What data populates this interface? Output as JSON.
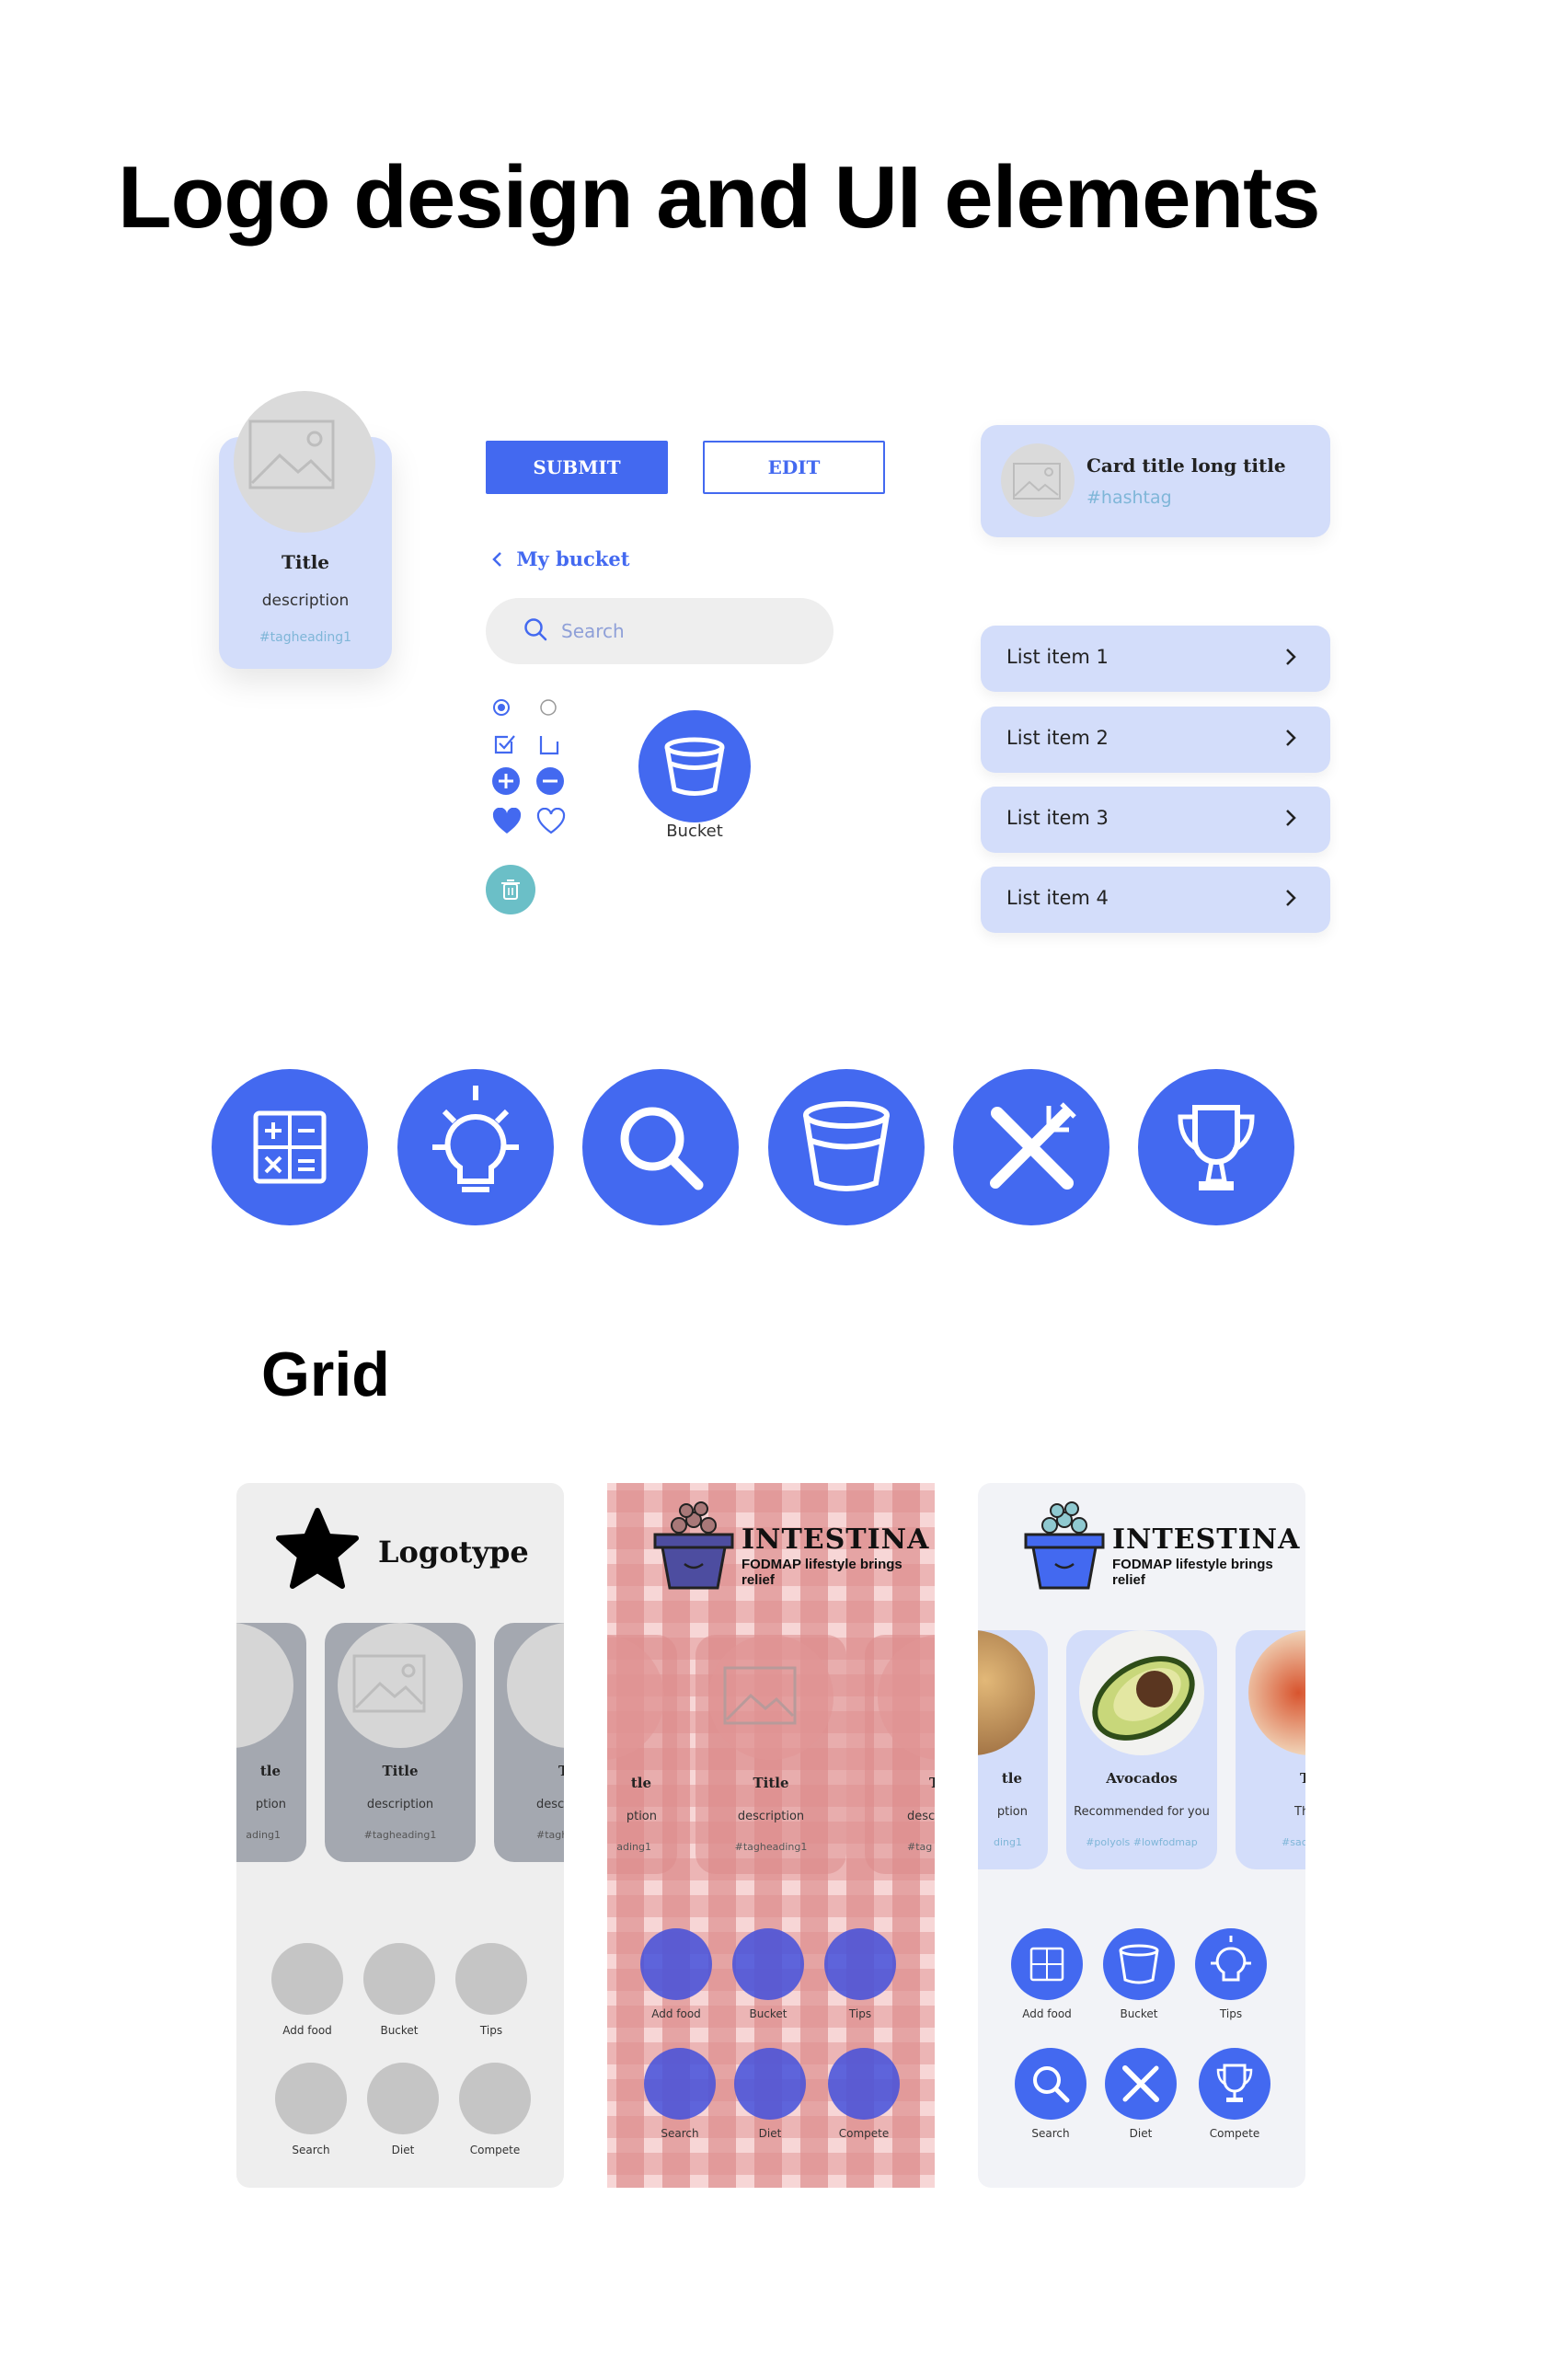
{
  "heading": "Logo design and UI elements",
  "profile_card": {
    "title": "Title",
    "description": "description",
    "tag": "#tagheading1"
  },
  "buttons": {
    "submit": "SUBMIT",
    "edit": "EDIT"
  },
  "back_link": "My bucket",
  "search": {
    "placeholder": "Search"
  },
  "bucket_label": "Bucket",
  "card": {
    "title": "Card title long title",
    "tag": "#hashtag"
  },
  "list_items": [
    "List item 1",
    "List item 2",
    "List item 3",
    "List item 4"
  ],
  "icons": [
    "calculator-icon",
    "lightbulb-icon",
    "search-icon",
    "bucket-icon",
    "fork-knife-icon",
    "trophy-icon"
  ],
  "colors": {
    "accent": "#4369f0",
    "card_bg": "#d3ddfa",
    "tag": "#7fb6d8",
    "trash": "#6bbfc7"
  },
  "grid_heading": "Grid",
  "panel1": {
    "logo": "Logotype",
    "cards": [
      {
        "title": "tle",
        "description": "ption",
        "tag": "ading1"
      },
      {
        "title": "Title",
        "description": "description",
        "tag": "#tagheading1"
      },
      {
        "title": "T",
        "description": "desc",
        "tag": "#tagh"
      }
    ],
    "shortcuts": [
      "Add food",
      "Bucket",
      "Tips",
      "Search",
      "Diet",
      "Compete"
    ]
  },
  "panel2": {
    "brand": "INTESTINA",
    "tagline": "FODMAP lifestyle brings relief",
    "cards": [
      {
        "title": "tle",
        "description": "ption",
        "tag": "ading1"
      },
      {
        "title": "Title",
        "description": "description",
        "tag": "#tagheading1"
      },
      {
        "title": "T",
        "description": "desc",
        "tag": "#tag"
      }
    ],
    "shortcuts": [
      "Add food",
      "Bucket",
      "Tips",
      "Search",
      "Diet",
      "Compete"
    ]
  },
  "panel3": {
    "brand": "INTESTINA",
    "tagline": "FODMAP lifestyle brings relief",
    "cards": [
      {
        "title": "tle",
        "description": "ption",
        "tag": "ding1"
      },
      {
        "title": "Avocados",
        "description": "Recommended for you",
        "tag": "#polyols #lowfodmap"
      },
      {
        "title": "T",
        "description": "Th",
        "tag": "#sac"
      }
    ],
    "shortcuts": [
      "Add food",
      "Bucket",
      "Tips",
      "Search",
      "Diet",
      "Compete"
    ]
  }
}
